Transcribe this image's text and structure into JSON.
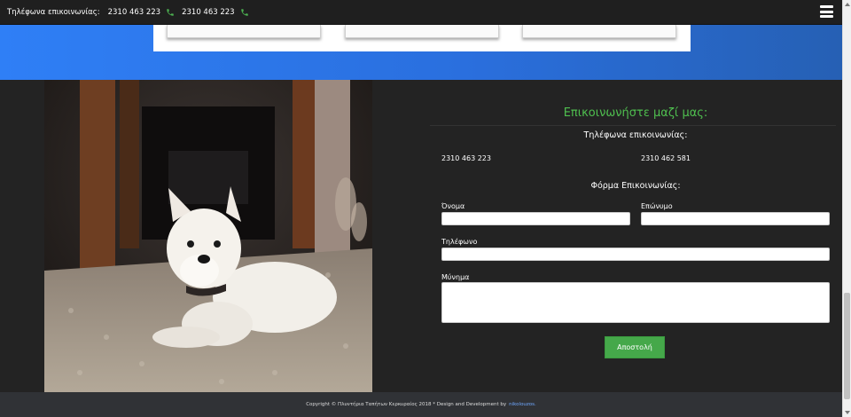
{
  "topbar": {
    "contact_label": "Τηλέφωνα επικοινωνίας:",
    "phone_1": "2310 463 223",
    "phone_2": "2310 463 223",
    "phone_icon": "phone-icon",
    "menu_icon": "hamburger-menu-icon"
  },
  "contact": {
    "title": "Επικοινωνήστε μαζί μας:",
    "phones_heading": "Τηλέφωνα επικοινωνίας:",
    "phone_1": "2310 463 223",
    "phone_2": "2310 462 581",
    "form_heading": "Φόρμα Επικοινωνίας:",
    "fields": {
      "first_name_label": "Όνομα",
      "last_name_label": "Επώνυμο",
      "phone_label": "Τηλέφωνο",
      "message_label": "Μύνημα"
    },
    "submit_label": "Αποστολή"
  },
  "footer": {
    "text": "Copyright © Πλυντήρια Ταπήτων Κερκυραίος 2018 * Design and Development by",
    "dev_link": "nikolouzos."
  },
  "colors": {
    "accent_green": "#4fbf4f",
    "button_green": "#45a84a",
    "blue_band": "#2a6fde",
    "dark_bg": "#232323"
  }
}
